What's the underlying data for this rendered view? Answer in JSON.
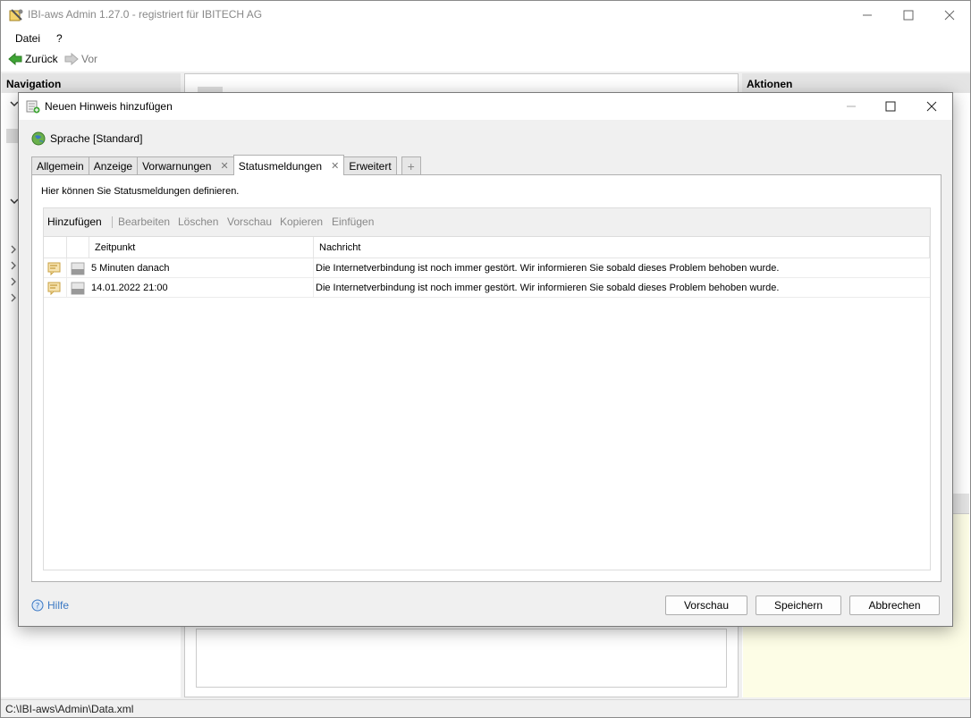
{
  "app": {
    "title": "IBI-aws Admin 1.27.0 - registriert für IBITECH AG",
    "menu": [
      "Datei",
      "?"
    ],
    "nav": {
      "back": "Zurück",
      "forward": "Vor"
    },
    "panes": {
      "navigation": "Navigation",
      "actions": "Aktionen"
    },
    "status_path": "C:\\IBI-aws\\Admin\\Data.xml"
  },
  "dialog": {
    "title": "Neuen Hinweis hinzufügen",
    "language": "Sprache [Standard]",
    "tabs": [
      {
        "label": "Allgemein",
        "closable": false,
        "active": false
      },
      {
        "label": "Anzeige",
        "closable": false,
        "active": false
      },
      {
        "label": "Vorwarnungen",
        "closable": true,
        "active": false
      },
      {
        "label": "Statusmeldungen",
        "closable": true,
        "active": true
      },
      {
        "label": "Erweitert",
        "closable": false,
        "active": false
      }
    ],
    "add_tab": "+",
    "description": "Hier können Sie Statusmeldungen definieren.",
    "toolbar": {
      "add": "Hinzufügen",
      "edit": "Bearbeiten",
      "delete": "Löschen",
      "preview": "Vorschau",
      "copy": "Kopieren",
      "paste": "Einfügen"
    },
    "columns": {
      "time": "Zeitpunkt",
      "message": "Nachricht"
    },
    "rows": [
      {
        "time": "5 Minuten danach",
        "message": "Die Internetverbindung ist noch immer gestört. Wir informieren Sie sobald dieses Problem behoben wurde."
      },
      {
        "time": "14.01.2022 21:00",
        "message": "Die Internetverbindung ist noch immer gestört. Wir informieren Sie sobald dieses Problem behoben wurde."
      }
    ],
    "help": "Hilfe",
    "buttons": {
      "preview": "Vorschau",
      "save": "Speichern",
      "cancel": "Abbrechen"
    }
  },
  "icons": {
    "app": "app-tools-icon",
    "dialog": "note-add-icon",
    "language": "globe-icon",
    "help": "help-circle-icon",
    "row_type": "message-icon",
    "row_state": "state-icon"
  },
  "colors": {
    "accent": "#3a78c4",
    "back_arrow": "#3fa535",
    "highlight_bg": "#fdfde6"
  }
}
